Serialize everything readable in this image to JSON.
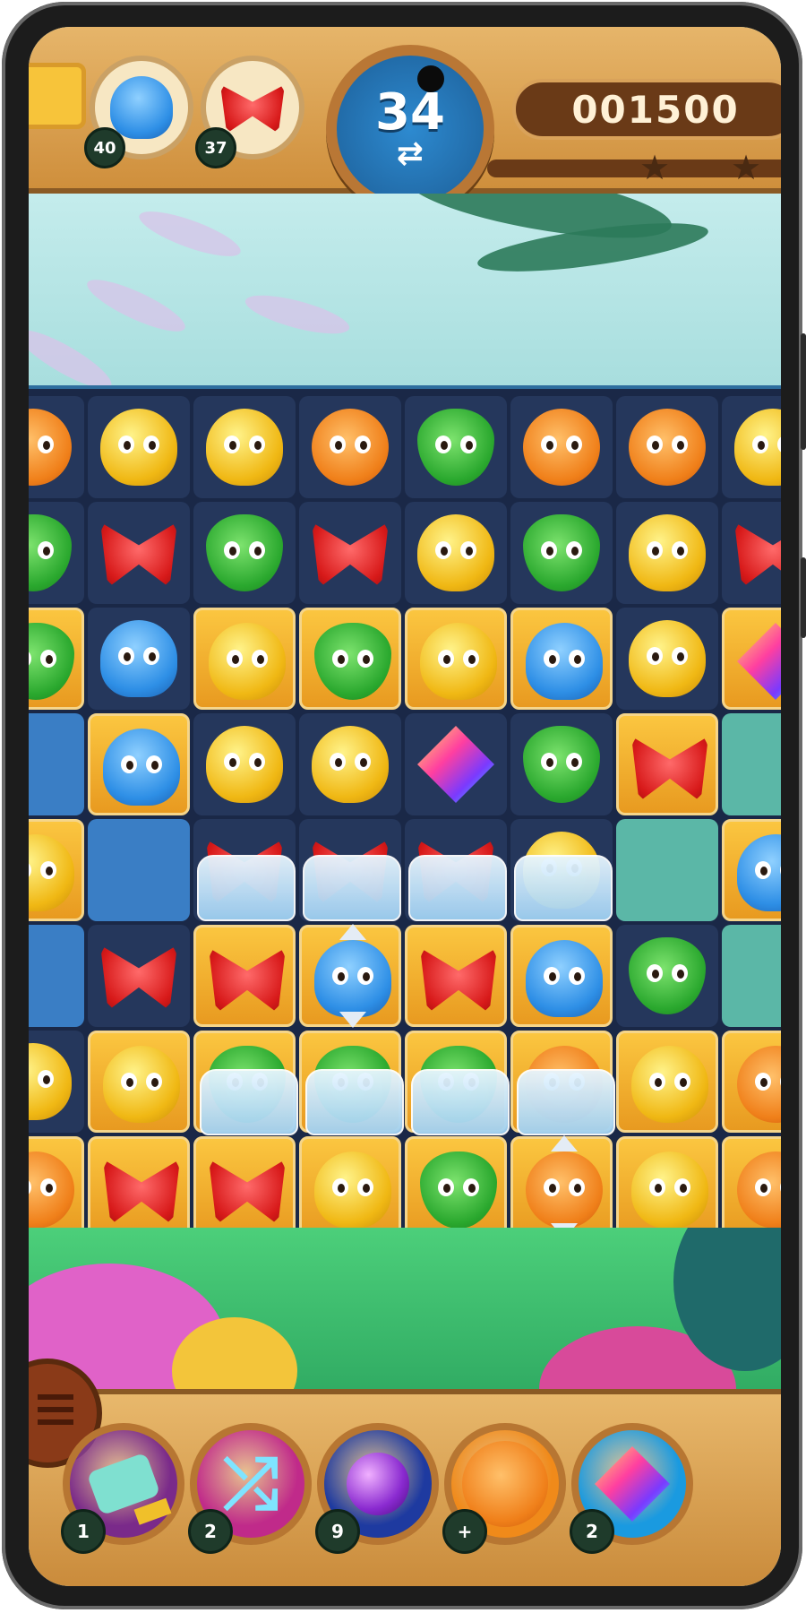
{
  "hud": {
    "moves_left": "34",
    "moves_icon": "swap-arrows-icon",
    "score": "001500",
    "goals": [
      {
        "piece": "octopus",
        "count": "40"
      },
      {
        "piece": "red-bow",
        "count": "37"
      }
    ],
    "stars_shown": 2,
    "stars_earned": 0
  },
  "board": {
    "rows": 8,
    "cols": 8,
    "grid": [
      [
        "lion",
        "bird",
        "bird",
        "lion",
        "frog",
        "lion",
        "lion",
        "bird"
      ],
      [
        "frog",
        "bow",
        "frog",
        "bow",
        "bird",
        "frog",
        "bird",
        "bow"
      ],
      [
        "frog",
        "octo",
        "bird",
        "frog",
        "bird",
        "octo",
        "bird",
        "gem"
      ],
      [
        "",
        "octo",
        "bird",
        "bird",
        "gem",
        "frog",
        "bow",
        ""
      ],
      [
        "bird",
        "",
        "bow",
        "bow",
        "bow",
        "bird",
        "",
        "octo"
      ],
      [
        "",
        "bow",
        "bow",
        "octo",
        "bow",
        "octo",
        "frog",
        ""
      ],
      [
        "bird",
        "bird",
        "frog",
        "frog",
        "frog",
        "lion",
        "bird",
        "lion"
      ],
      [
        "lion",
        "bow",
        "bow",
        "bird",
        "frog",
        "lion",
        "bird",
        "lion"
      ]
    ],
    "tiles": [
      [
        "dark",
        "dark",
        "dark",
        "dark",
        "dark",
        "dark",
        "dark",
        "dark"
      ],
      [
        "dark",
        "dark",
        "dark",
        "dark",
        "dark",
        "dark",
        "dark",
        "dark"
      ],
      [
        "gold",
        "dark",
        "gold",
        "gold",
        "gold",
        "gold",
        "dark",
        "gold"
      ],
      [
        "water",
        "gold",
        "dark",
        "dark",
        "dark",
        "dark",
        "gold",
        "teal"
      ],
      [
        "gold",
        "water",
        "dark",
        "dark",
        "dark",
        "dark",
        "teal",
        "gold"
      ],
      [
        "water",
        "dark",
        "gold",
        "gold",
        "gold",
        "gold",
        "dark",
        "teal"
      ],
      [
        "dark",
        "gold",
        "gold",
        "gold",
        "gold",
        "gold",
        "gold",
        "gold"
      ],
      [
        "gold",
        "gold",
        "gold",
        "gold",
        "gold",
        "gold",
        "gold",
        "gold"
      ]
    ],
    "ice_cells": [
      [
        4,
        2
      ],
      [
        4,
        3
      ],
      [
        4,
        4
      ],
      [
        4,
        5
      ],
      [
        6,
        2
      ],
      [
        6,
        3
      ],
      [
        6,
        4
      ],
      [
        6,
        5
      ]
    ],
    "striped_cells": [
      [
        5,
        3
      ],
      [
        7,
        5
      ]
    ]
  },
  "boosters": [
    {
      "name": "hammer",
      "icon": "hammer-icon",
      "count": "1",
      "color": "#7a2a8a"
    },
    {
      "name": "shuffle",
      "icon": "shuffle-icon",
      "count": "2",
      "color": "#c02a8a"
    },
    {
      "name": "bomb",
      "icon": "bomb-icon",
      "count": "9",
      "color": "#1e3aa0"
    },
    {
      "name": "lion",
      "icon": "lion-icon",
      "count": "+",
      "color": "#f08a1a"
    },
    {
      "name": "gem",
      "icon": "rainbow-gem-icon",
      "count": "2",
      "color": "#1a9ae0"
    }
  ]
}
